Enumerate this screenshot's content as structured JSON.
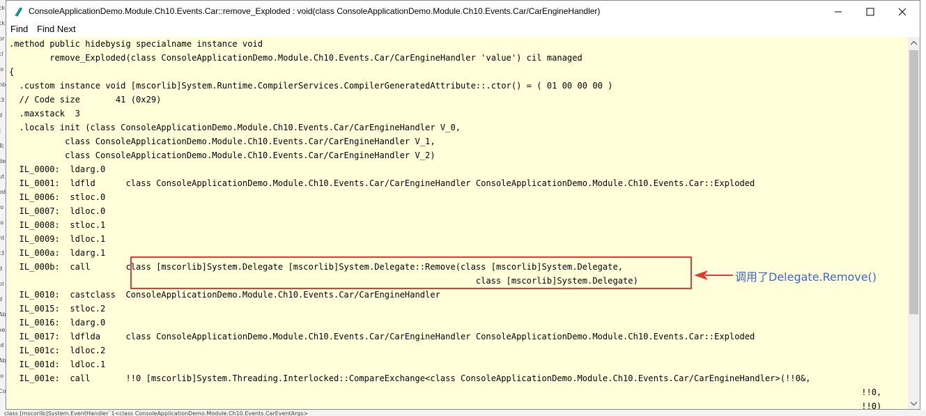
{
  "window": {
    "title": "ConsoleApplicationDemo.Module.Ch10.Events.Car::remove_Exploded : void(class ConsoleApplicationDemo.Module.Ch10.Events.Car/CarEngineHandler)"
  },
  "menu": {
    "find_label": "Find",
    "find_next_label": "Find Next"
  },
  "code_lines": [
    ".method public hidebysig specialname instance void",
    "        remove_Exploded(class ConsoleApplicationDemo.Module.Ch10.Events.Car/CarEngineHandler 'value') cil managed",
    "{",
    "  .custom instance void [mscorlib]System.Runtime.CompilerServices.CompilerGeneratedAttribute::.ctor() = ( 01 00 00 00 )",
    "  // Code size       41 (0x29)",
    "  .maxstack  3",
    "  .locals init (class ConsoleApplicationDemo.Module.Ch10.Events.Car/CarEngineHandler V_0,",
    "           class ConsoleApplicationDemo.Module.Ch10.Events.Car/CarEngineHandler V_1,",
    "           class ConsoleApplicationDemo.Module.Ch10.Events.Car/CarEngineHandler V_2)",
    "  IL_0000:  ldarg.0",
    "  IL_0001:  ldfld      class ConsoleApplicationDemo.Module.Ch10.Events.Car/CarEngineHandler ConsoleApplicationDemo.Module.Ch10.Events.Car::Exploded",
    "  IL_0006:  stloc.0",
    "  IL_0007:  ldloc.0",
    "  IL_0008:  stloc.1",
    "  IL_0009:  ldloc.1",
    "  IL_000a:  ldarg.1",
    "  IL_000b:  call       class [mscorlib]System.Delegate [mscorlib]System.Delegate::Remove(class [mscorlib]System.Delegate,",
    "                                                                                            class [mscorlib]System.Delegate)",
    "  IL_0010:  castclass  ConsoleApplicationDemo.Module.Ch10.Events.Car/CarEngineHandler",
    "  IL_0015:  stloc.2",
    "  IL_0016:  ldarg.0",
    "  IL_0017:  ldflda     class ConsoleApplicationDemo.Module.Ch10.Events.Car/CarEngineHandler ConsoleApplicationDemo.Module.Ch10.Events.Car::Exploded",
    "  IL_001c:  ldloc.2",
    "  IL_001d:  ldloc.1",
    "  IL_001e:  call       !!0 [mscorlib]System.Threading.Interlocked::CompareExchange<class ConsoleApplicationDemo.Module.Ch10.Events.Car/CarEngineHandler>(!!0&,",
    "                                                                                                                                                                        !!0,",
    "                                                                                                                                                                        !!0)"
  ],
  "annotation": {
    "text": "调用了Delegate.Remove()",
    "color": "#3c66c8",
    "box_color": "#e53935"
  },
  "background": {
    "left_fragments": [
      "ck",
      "ck",
      "pr",
      "cl",
      "lo",
      "nb",
      "t3",
      "d",
      "t",
      "Tc",
      "de",
      "ut",
      "od",
      "lo",
      "lo",
      "nt",
      "t3",
      "d",
      "pl",
      "d",
      "Ab",
      "xe",
      "ld",
      "Ab",
      "lo",
      "Co"
    ],
    "bottom_text": "class [mscorlib]System.EventHandler`1<class ConsoleApplicationDemo.Module.Ch10.Events.CarEventArgs>"
  },
  "colors": {
    "editor_bg": "#ffffd9",
    "scroll_thumb": "#c2c2c2"
  }
}
